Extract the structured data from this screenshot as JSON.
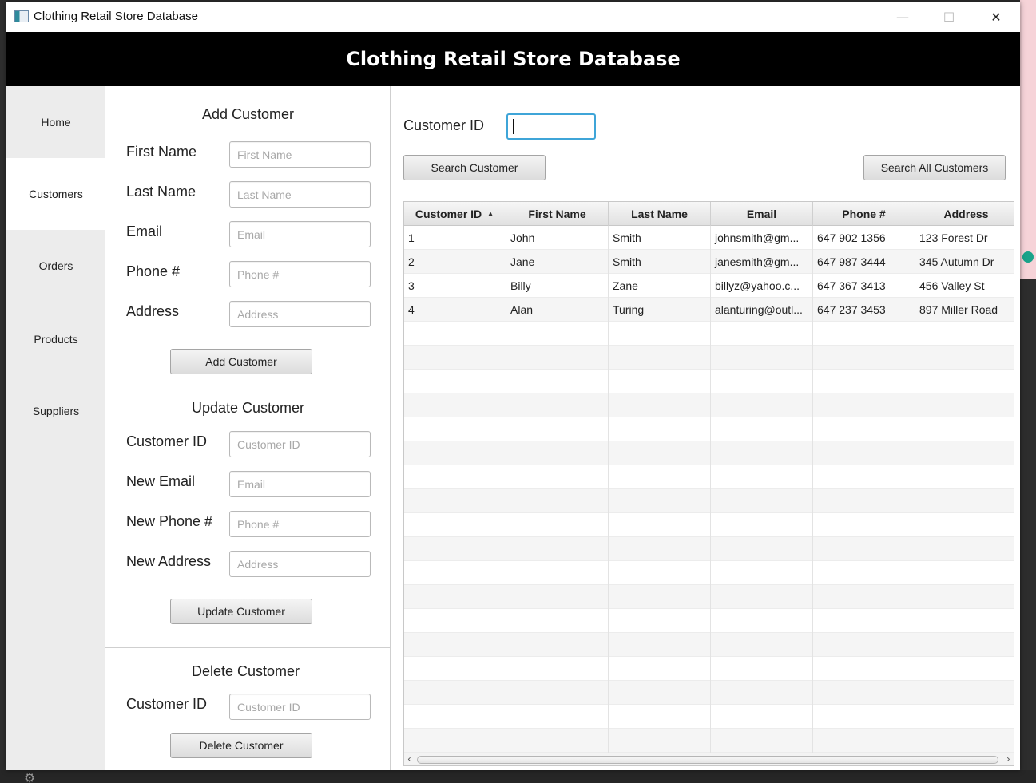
{
  "window": {
    "title": "Clothing Retail Store Database"
  },
  "header": {
    "title": "Clothing Retail Store Database"
  },
  "titlebar_controls": {
    "minimize": "—",
    "maximize": "☐",
    "close": "✕"
  },
  "sidebar": {
    "items": [
      {
        "label": "Home",
        "active": false
      },
      {
        "label": "Customers",
        "active": true
      },
      {
        "label": "Orders",
        "active": false
      },
      {
        "label": "Products",
        "active": false
      },
      {
        "label": "Suppliers",
        "active": false
      }
    ]
  },
  "add_customer": {
    "title": "Add Customer",
    "fields": [
      {
        "label": "First Name",
        "placeholder": "First Name",
        "value": ""
      },
      {
        "label": "Last Name",
        "placeholder": "Last Name",
        "value": ""
      },
      {
        "label": "Email",
        "placeholder": "Email",
        "value": ""
      },
      {
        "label": "Phone #",
        "placeholder": "Phone #",
        "value": ""
      },
      {
        "label": "Address",
        "placeholder": "Address",
        "value": ""
      }
    ],
    "button": "Add Customer"
  },
  "update_customer": {
    "title": "Update Customer",
    "fields": [
      {
        "label": "Customer ID",
        "placeholder": "Customer ID",
        "value": ""
      },
      {
        "label": "New Email",
        "placeholder": "Email",
        "value": ""
      },
      {
        "label": "New Phone #",
        "placeholder": "Phone #",
        "value": ""
      },
      {
        "label": "New Address",
        "placeholder": "Address",
        "value": ""
      }
    ],
    "button": "Update Customer"
  },
  "delete_customer": {
    "title": "Delete Customer",
    "fields": [
      {
        "label": "Customer ID",
        "placeholder": "Customer ID",
        "value": ""
      }
    ],
    "button": "Delete Customer"
  },
  "search": {
    "label": "Customer ID",
    "value": "",
    "search_button": "Search Customer",
    "search_all_button": "Search All Customers"
  },
  "table": {
    "columns": [
      "Customer ID",
      "First Name",
      "Last Name",
      "Email",
      "Phone #",
      "Address"
    ],
    "sorted_column": "Customer ID",
    "sort_indicator": "▲",
    "rows": [
      [
        "1",
        "John",
        "Smith",
        "johnsmith@gm...",
        "647 902 1356",
        "123 Forest Dr"
      ],
      [
        "2",
        "Jane",
        "Smith",
        "janesmith@gm...",
        "647 987 3444",
        "345 Autumn Dr"
      ],
      [
        "3",
        "Billy",
        "Zane",
        "billyz@yahoo.c...",
        "647 367 3413",
        "456 Valley St"
      ],
      [
        "4",
        "Alan",
        "Turing",
        "alanturing@outl...",
        "647 237 3453",
        "897 Miller Road"
      ]
    ],
    "scroll_left": "‹",
    "scroll_right": "›"
  },
  "colors": {
    "header_bg": "#000000",
    "sidebar_bg": "#ececec",
    "focus_border": "#3fa5d8"
  }
}
